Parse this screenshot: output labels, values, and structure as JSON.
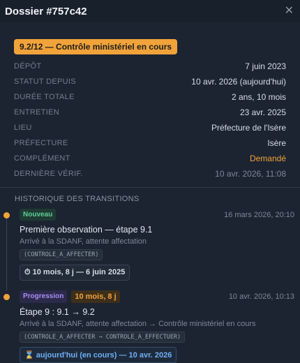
{
  "header": {
    "title": "Dossier #757c42",
    "close_icon": "close-icon"
  },
  "status_badge": "9.2/12 — Contrôle ministériel en cours",
  "details": [
    {
      "label": "DÉPÔT",
      "value": "7 juin 2023",
      "tone": "normal"
    },
    {
      "label": "STATUT DEPUIS",
      "value": "10 avr. 2026 (aujourd'hui)",
      "tone": "normal"
    },
    {
      "label": "DURÉE TOTALE",
      "value": "2 ans, 10 mois",
      "tone": "normal"
    },
    {
      "label": "ENTRETIEN",
      "value": "23 avr. 2025",
      "tone": "normal"
    },
    {
      "label": "LIEU",
      "value": "Préfecture de l'Isère",
      "tone": "normal"
    },
    {
      "label": "PRÉFECTURE",
      "value": "Isère",
      "tone": "normal"
    },
    {
      "label": "COMPLÉMENT",
      "value": "Demandé",
      "tone": "orange"
    },
    {
      "label": "DERNIÈRE VÉRIF.",
      "value": "10 avr. 2026, 11:08",
      "tone": "muted"
    }
  ],
  "history": {
    "title": "HISTORIQUE DES TRANSITIONS",
    "entries": [
      {
        "badge": "Nouveau",
        "date": "16 mars 2026, 20:10",
        "etape": "Première observation — étape 9.1",
        "desc": "Arrivé à la SDANF, attente affectation",
        "code": "(CONTROLE_A_AFFECTER)",
        "pill_icon": "stopwatch-icon",
        "pill": "⏱ 10 mois, 8 j — 6 juin 2025"
      },
      {
        "badge": "Progression",
        "duration": "10 mois, 8 j",
        "date": "10 avr. 2026, 10:13",
        "etape": "Étape 9 : 9.1 → 9.2",
        "desc": "Arrivé à la SDANF, attente affectation → Contrôle ministériel en cours",
        "code": "(CONTROLE_A_AFFECTER → CONTROLE_A_EFFECTUER)",
        "pill_icon": "hourglass-icon",
        "pill": "⌛ aujourd'hui (en cours) — 10 avr. 2026"
      }
    ]
  },
  "colors": {
    "accent": "#f1a33a",
    "new": "#5fcf9a",
    "progression": "#a88ef2",
    "current": "#6fb0f5"
  }
}
